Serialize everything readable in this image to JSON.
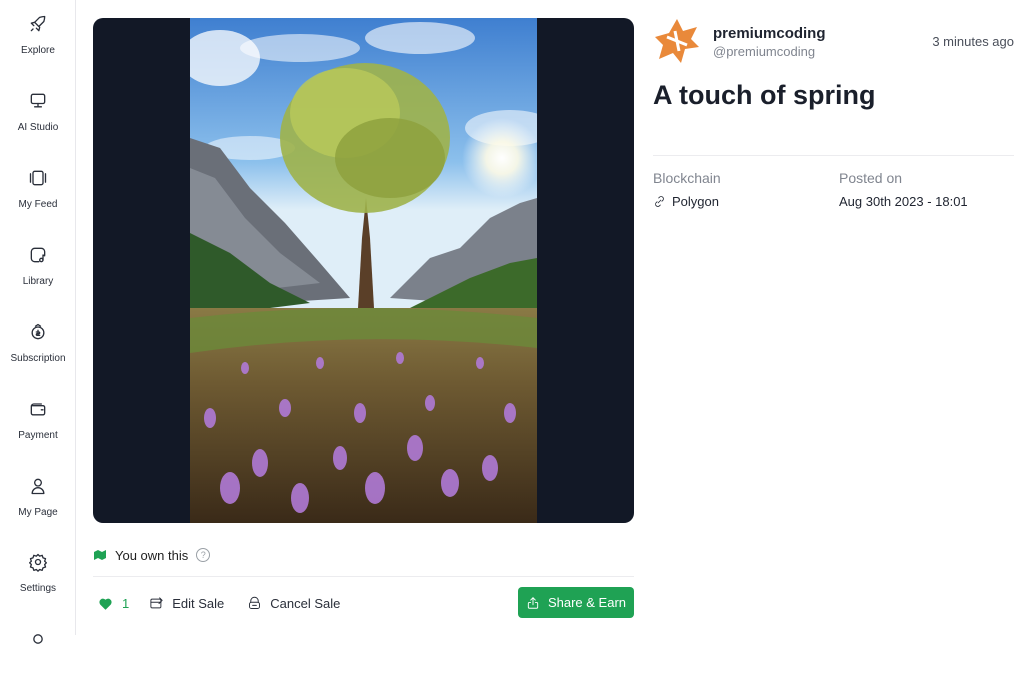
{
  "sidebar": {
    "items": [
      {
        "label": "Explore",
        "icon": "rocket-icon"
      },
      {
        "label": "AI Studio",
        "icon": "monitor-icon"
      },
      {
        "label": "My Feed",
        "icon": "feed-icon"
      },
      {
        "label": "Library",
        "icon": "music-note-icon"
      },
      {
        "label": "Subscription",
        "icon": "subscription-icon"
      },
      {
        "label": "Payment",
        "icon": "wallet-icon"
      },
      {
        "label": "My Page",
        "icon": "person-icon"
      },
      {
        "label": "Settings",
        "icon": "gear-icon"
      }
    ]
  },
  "post": {
    "image_alt": "Tree with crocus flowers in a mountain meadow",
    "owned_text": "You own this",
    "help_glyph": "?",
    "likes": "1",
    "edit_label": "Edit Sale",
    "cancel_label": "Cancel Sale",
    "share_label": "Share & Earn"
  },
  "author": {
    "username": "premiumcoding",
    "handle": "@premiumcoding",
    "time": "3 minutes ago"
  },
  "details": {
    "title": "A touch of spring",
    "blockchain_label": "Blockchain",
    "blockchain_value": "Polygon",
    "posted_label": "Posted on",
    "posted_value": "Aug 30th 2023 - 18:01"
  },
  "colors": {
    "accent": "#1fa254",
    "media_bg": "#121826",
    "avatar": "#e9893a"
  }
}
